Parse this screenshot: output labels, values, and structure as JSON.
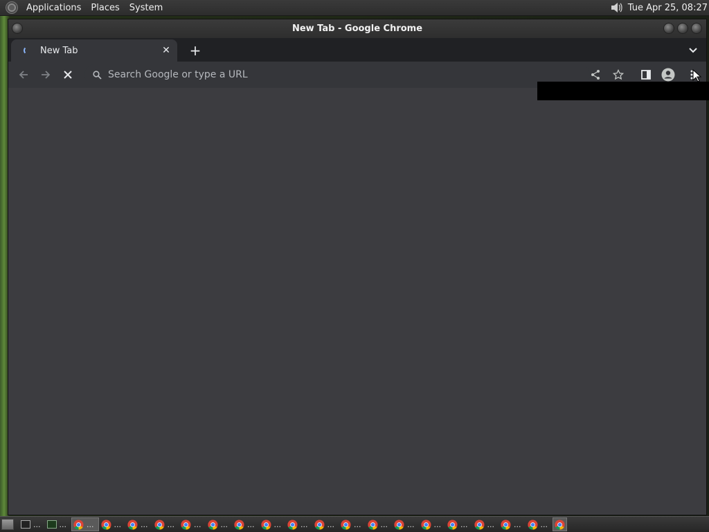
{
  "panel": {
    "menus": [
      "Applications",
      "Places",
      "System"
    ],
    "clock": "Tue Apr 25, 08:27"
  },
  "window": {
    "title": "New Tab - Google Chrome"
  },
  "tab": {
    "title": "New Tab",
    "close_glyph": "✕"
  },
  "newtab_glyph": "+",
  "omnibox": {
    "placeholder": "Search Google or type a URL",
    "value": ""
  },
  "taskbar": {
    "ellipsis": "...",
    "chrome_windows": 19
  },
  "icons": {
    "back": "arrow-left-icon",
    "forward": "arrow-right-icon",
    "stop": "close-icon",
    "search": "search-icon",
    "share": "share-icon",
    "bookmark": "star-icon",
    "side_panel": "side-panel-icon",
    "profile": "profile-icon",
    "menu": "kebab-menu-icon",
    "tab_search": "chevron-down-icon"
  },
  "colors": {
    "frame": "#202124",
    "toolbar": "#35363a",
    "content": "#3c3c40",
    "text": "#e8eaed"
  }
}
